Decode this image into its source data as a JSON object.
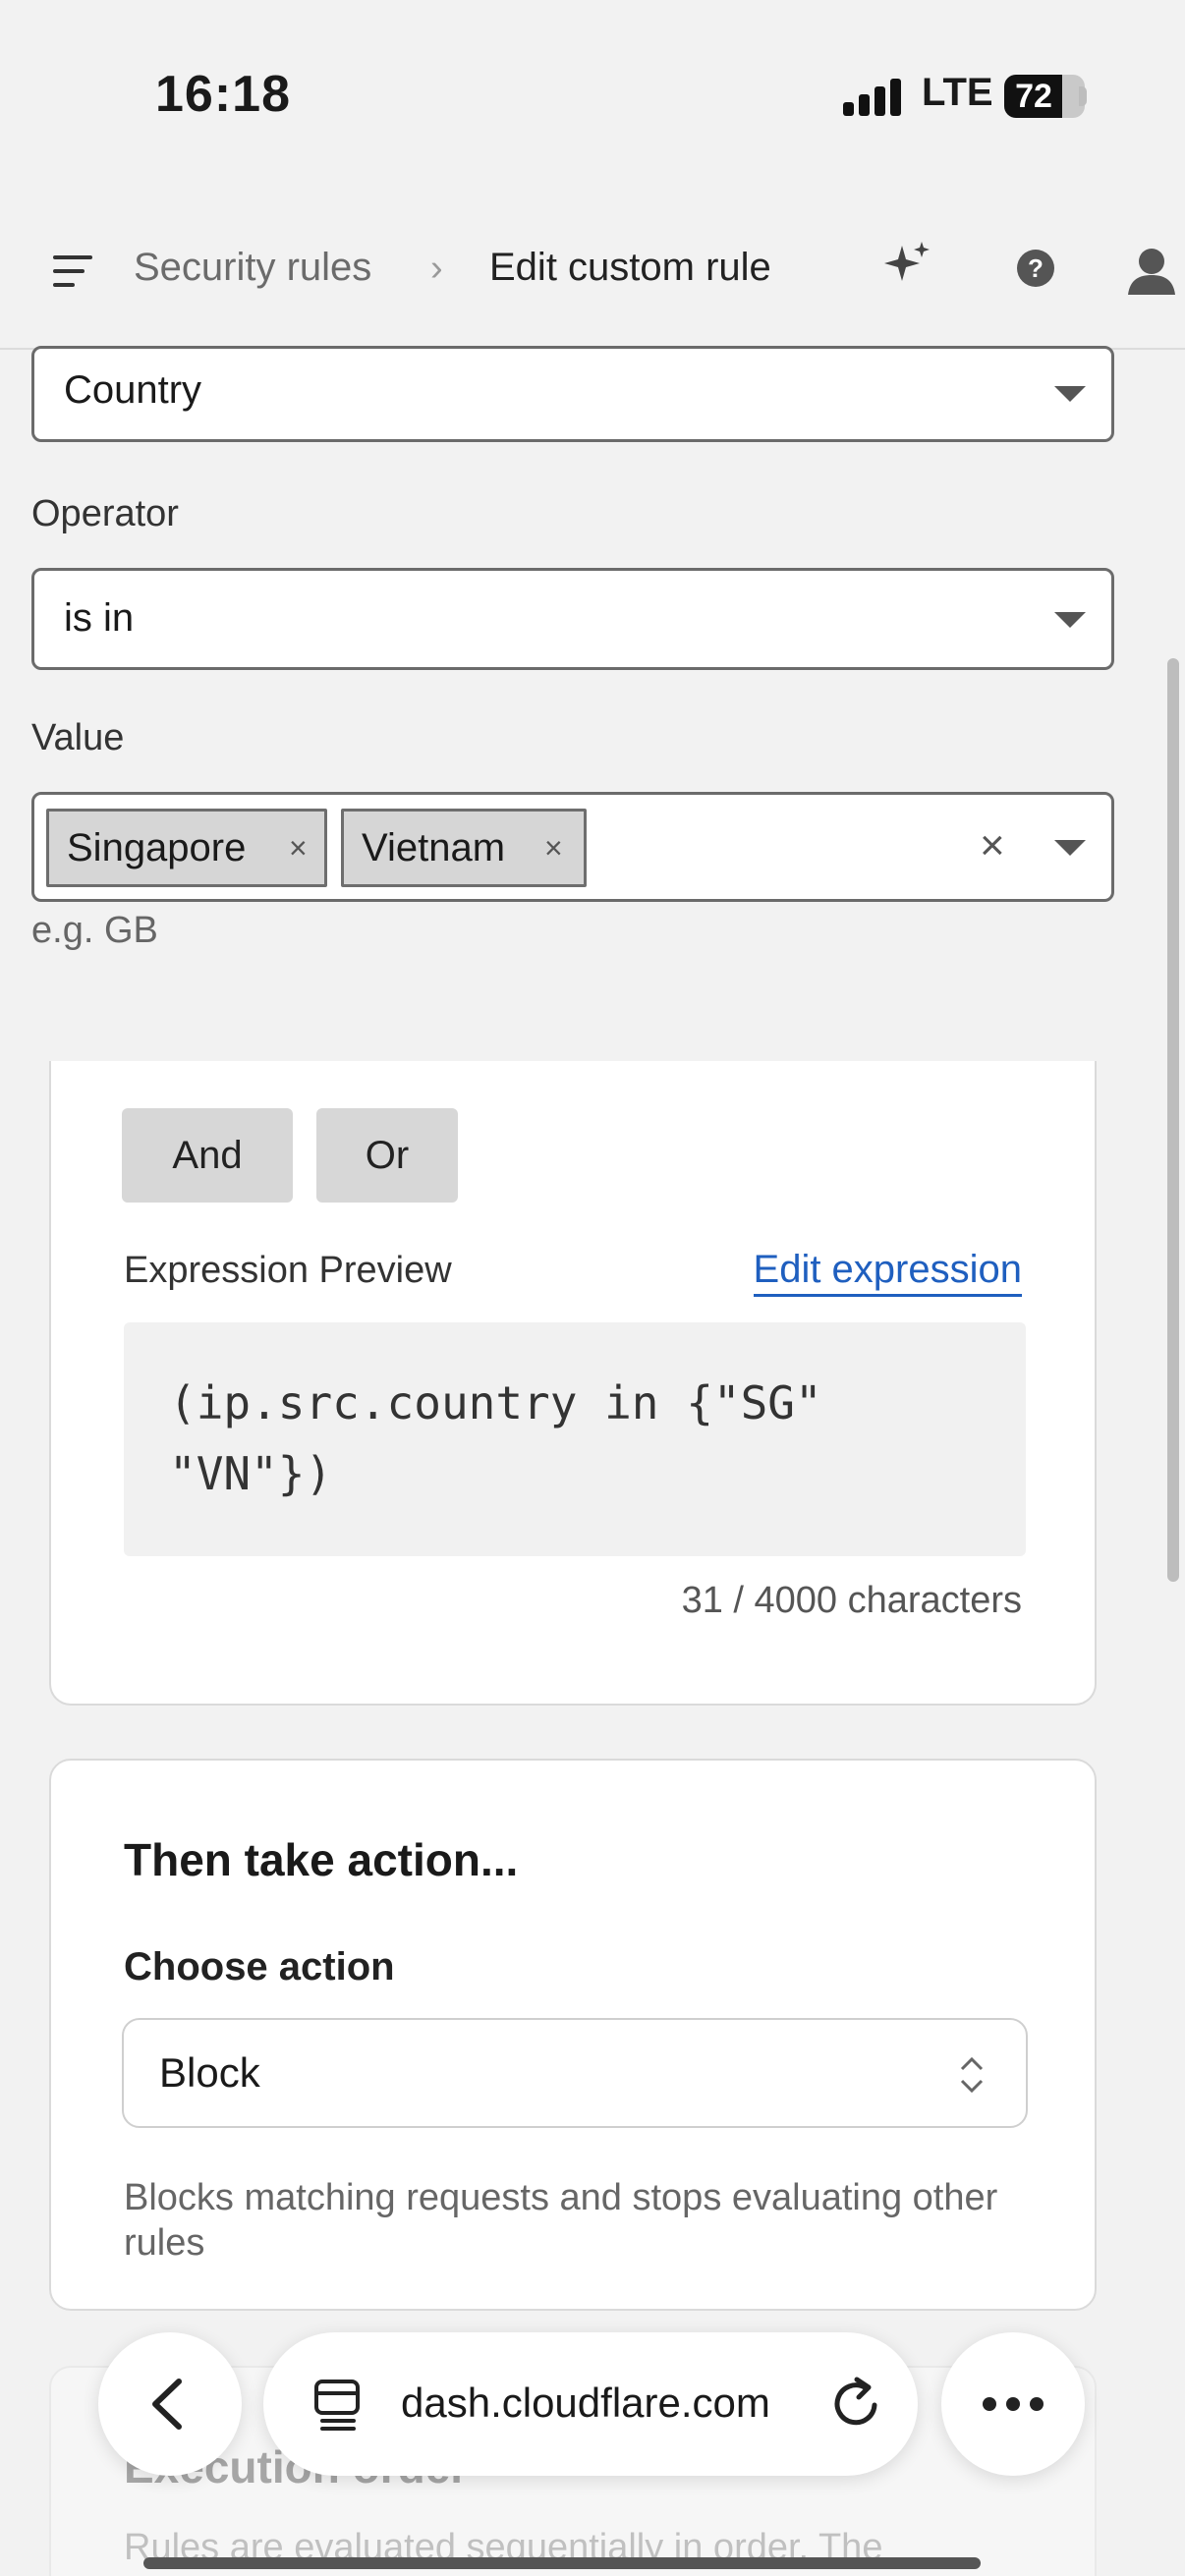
{
  "status": {
    "time": "16:18",
    "network": "LTE",
    "battery_percent": 72,
    "battery_label": "72"
  },
  "header": {
    "breadcrumb_parent": "Security rules",
    "breadcrumb_separator": "›",
    "breadcrumb_current": "Edit custom rule",
    "icons": [
      "menu-icon",
      "sparkle-icon",
      "help-icon",
      "user-icon"
    ]
  },
  "filter": {
    "field_value": "Country",
    "operator_label": "Operator",
    "operator_value": "is in",
    "value_label": "Value",
    "values": [
      "Singapore",
      "Vietnam"
    ],
    "chip_remove_glyph": "×",
    "clear_glyph": "×",
    "hint": "e.g. GB"
  },
  "expression": {
    "and_label": "And",
    "or_label": "Or",
    "preview_label": "Expression Preview",
    "edit_link": "Edit expression",
    "code": "(ip.src.country in {\"SG\" \"VN\"})",
    "char_count": "31 / 4000 characters"
  },
  "action": {
    "title": "Then take action...",
    "choose_label": "Choose action",
    "selected": "Block",
    "description": "Blocks matching requests and stops evaluating other rules"
  },
  "execution": {
    "title": "Execution order",
    "description": "Rules are evaluated sequentially in order. The"
  },
  "browser": {
    "url": "dash.cloudflare.com"
  }
}
